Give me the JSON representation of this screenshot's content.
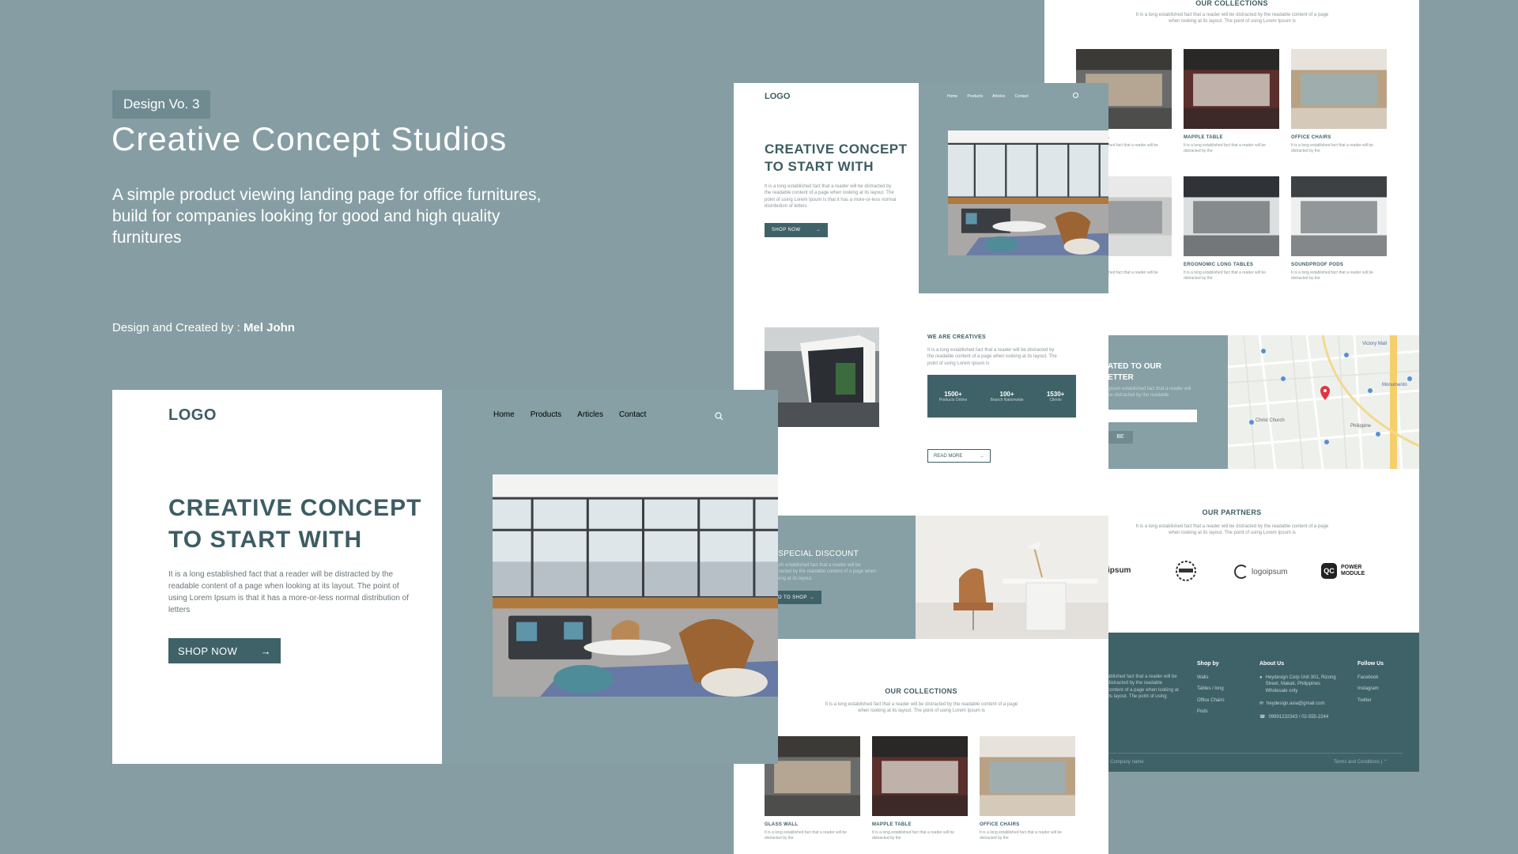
{
  "intro": {
    "badge": "Design Vo. 3",
    "title": "Creative Concept Studios",
    "description": "A simple product viewing landing page for office furnitures, build for companies looking for good and high quality furnitures",
    "credit_prefix": "Design and Created by : ",
    "credit_name": "Mel John"
  },
  "nav": {
    "logo": "LOGO",
    "items": [
      "Home",
      "Products",
      "Articles",
      "Contact"
    ]
  },
  "hero": {
    "heading_line1": "CREATIVE CONCEPT",
    "heading_line2": "TO START WITH",
    "body": "It is a long established fact that a reader will be distracted by the readable content of a page when looking at its layout. The point of using Lorem Ipsum is that it has a more-or-less normal distribution of letters",
    "cta": "SHOP NOW"
  },
  "creatives": {
    "title": "WE ARE CREATIVES",
    "body": "It is a long established fact that a reader will be distracted by the readable content of a page when looking at its layout. The point of using Lorem Ipsum is",
    "stats": [
      {
        "value": "1500+",
        "label": "Products Online"
      },
      {
        "value": "100+",
        "label": "Branch Nationwide"
      },
      {
        "value": "1530+",
        "label": "Clients"
      }
    ],
    "cta": "READ MORE"
  },
  "discount": {
    "title": "T SPECIAL DISCOUNT",
    "body": "Ipsum established fact that a reader will be distracted by the readable content of a page when looking at its layout.",
    "cta": "O TO SHOP"
  },
  "collections": {
    "title": "OUR COLLECTIONS",
    "body": "It is a long established fact that a reader will be distracted by the readable content of a page when looking at its layout. The point of using Lorem Ipsum is",
    "items": [
      {
        "name": "GLASS WALL",
        "desc": "It is a long established fact that a reader will be distracted by the"
      },
      {
        "name": "MAPPLE TABLE",
        "desc": "It is a long established fact that a reader will be distracted by the"
      },
      {
        "name": "OFFICE CHAIRS",
        "desc": "It is a long established fact that a reader will be distracted by the"
      },
      {
        "name": "BLE",
        "desc": "It is a long established fact that a reader will be distracted by the"
      },
      {
        "name": "ERGONOMIC LONG TABLES",
        "desc": "It is a long established fact that a reader will be distracted by the"
      },
      {
        "name": "SOUNDPROOF PODS",
        "desc": "It is a long established fact that a reader will be distracted by the"
      }
    ]
  },
  "newsletter": {
    "title_line1": "ATED TO OUR",
    "title_line2": "ETTER",
    "body": "Ipsum established fact that a reader will be distracted by the readable",
    "button": "BE"
  },
  "map_labels": [
    "Victory Mall",
    "Monumento",
    "Christ Church",
    "Philippine"
  ],
  "partners": {
    "title": "OUR PARTNERS",
    "body": "It is a long established fact that a reader will be distracted by the readable content of a page when looking at its layout. The point of using Lorem Ipsum is",
    "logos": [
      "ipsum",
      "logoipsum",
      "POWER",
      "MODULE",
      "QC"
    ]
  },
  "footer": {
    "intro": "ablished fact that a reader will be distracted by the readable content of a page when looking at its layout. The point of using",
    "shop_title": "Shop by",
    "shop_items": [
      "Walls",
      "Tables / long",
      "Office Chairs",
      "Pods"
    ],
    "about_title": "About Us",
    "address": "Heydesign Corp Unit 301, Rizong Street, Makati, Philippines Wholesale only",
    "email": "heydesign.asia@gmail.com",
    "phone": "09991232343 / 02-555-2244",
    "follow_title": "Follow Us",
    "follow_items": [
      "Facebook",
      "Instagram",
      "Twitter"
    ],
    "copyright": "| Company name",
    "terms": "Terms and Conditions"
  },
  "colors": {
    "background": "#869ea3",
    "teal": "#86a0a5",
    "dark_teal": "#3f6268",
    "heading": "#3c5d63"
  }
}
